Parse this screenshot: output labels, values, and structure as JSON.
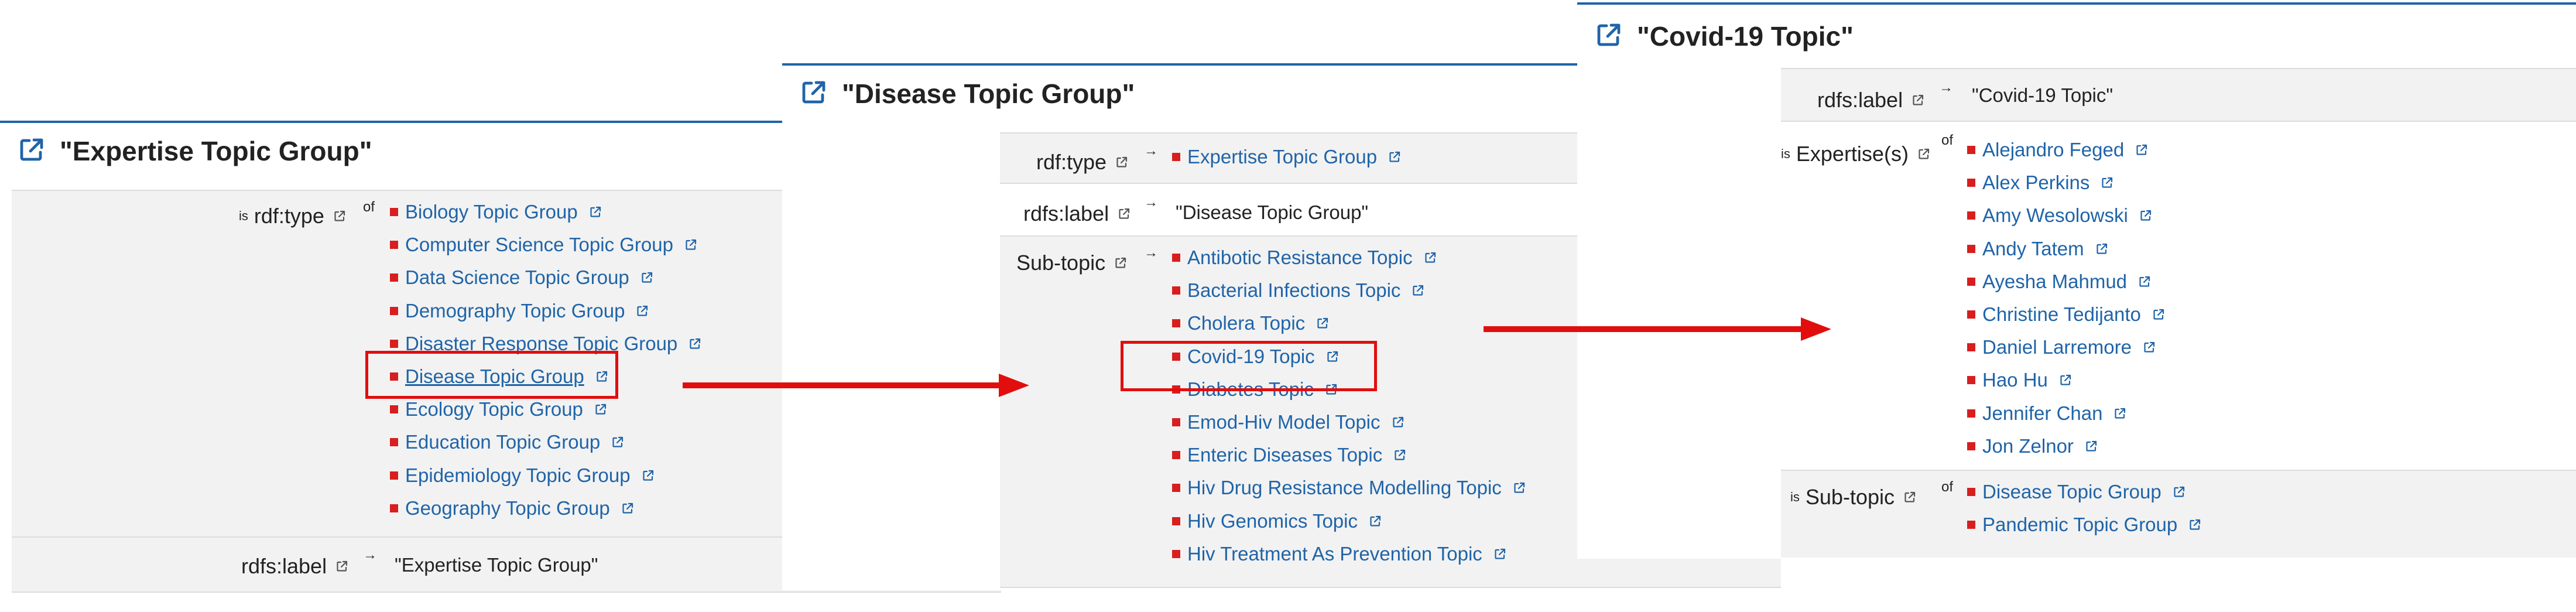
{
  "panel1": {
    "title": "\"Expertise Topic Group\"",
    "rows": [
      {
        "is_prefix": "is",
        "label": "rdf:type",
        "sup": "of",
        "items": [
          "Biology Topic Group",
          "Computer Science Topic Group",
          "Data Science Topic Group",
          "Demography Topic Group",
          "Disaster Response Topic Group",
          "Disease Topic Group",
          "Ecology Topic Group",
          "Education Topic Group",
          "Epidemiology Topic Group",
          "Geography Topic Group"
        ]
      },
      {
        "label": "rdfs:label",
        "sup": "→",
        "value": "\"Expertise Topic Group\""
      }
    ]
  },
  "panel2": {
    "title": "\"Disease Topic Group\"",
    "rows": [
      {
        "label": "rdf:type",
        "sup": "→",
        "items": [
          "Expertise Topic Group"
        ]
      },
      {
        "label": "rdfs:label",
        "sup": "→",
        "value": "\"Disease Topic Group\""
      },
      {
        "label": "Sub-topic",
        "sup": "→",
        "items": [
          "Antibotic Resistance Topic",
          "Bacterial Infections Topic",
          "Cholera Topic",
          "Covid-19 Topic",
          "Diabetes Topic",
          "Emod-Hiv Model Topic",
          "Enteric Diseases Topic",
          "Hiv Drug Resistance Modelling Topic",
          "Hiv Genomics Topic",
          "Hiv Treatment As Prevention Topic"
        ]
      }
    ]
  },
  "panel3": {
    "title": "\"Covid-19 Topic\"",
    "rows": [
      {
        "label": "rdfs:label",
        "sup": "→",
        "value": "\"Covid-19 Topic\""
      },
      {
        "is_prefix": "is",
        "label": "Expertise(s)",
        "sup": "of",
        "items": [
          "Alejandro Feged",
          "Alex Perkins",
          "Amy Wesolowski",
          "Andy Tatem",
          "Ayesha Mahmud",
          "Christine Tedijanto",
          "Daniel Larremore",
          "Hao Hu",
          "Jennifer Chan",
          "Jon Zelnor"
        ]
      },
      {
        "is_prefix": "is",
        "label": "Sub-topic",
        "sup": "of",
        "items": [
          "Disease Topic Group",
          "Pandemic Topic Group"
        ]
      }
    ]
  },
  "colors": {
    "link": "#1f64a8",
    "bullet": "#d81e1e",
    "highlight": "#e20e0e",
    "row_bg": "#f2f2f2",
    "header_rule": "#1f64a8"
  },
  "icons": {
    "external": "external-link-icon",
    "arrow": "red-right-arrow"
  }
}
